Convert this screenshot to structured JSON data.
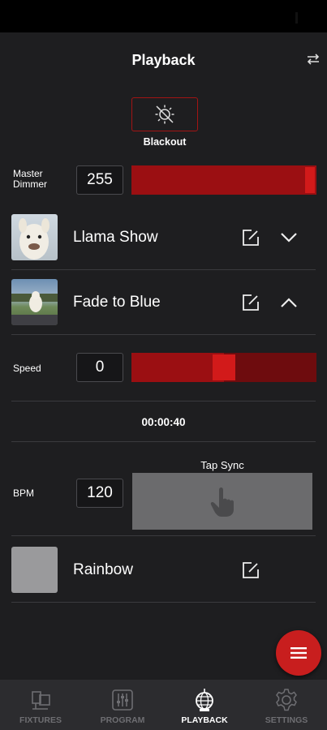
{
  "header": {
    "title": "Playback"
  },
  "blackout": {
    "label": "Blackout"
  },
  "master": {
    "label_line1": "Master",
    "label_line2": "Dimmer",
    "value": "255",
    "level": 1.0
  },
  "shows": [
    {
      "name": "Llama Show",
      "expanded": false
    },
    {
      "name": "Fade to Blue",
      "expanded": true
    }
  ],
  "speed": {
    "label": "Speed",
    "value": "0",
    "level": 0.5
  },
  "timer": "00:00:40",
  "bpm": {
    "label": "BPM",
    "value": "120",
    "tap_label": "Tap Sync"
  },
  "rainbow": {
    "name": "Rainbow"
  },
  "nav": [
    {
      "label": "FIXTURES",
      "icon": "fixture-icon",
      "active": false
    },
    {
      "label": "PROGRAM",
      "icon": "sliders-icon",
      "active": false
    },
    {
      "label": "PLAYBACK",
      "icon": "disco-ball-icon",
      "active": true
    },
    {
      "label": "SETTINGS",
      "icon": "gear-icon",
      "active": false
    }
  ],
  "colors": {
    "accent": "#c81e1e",
    "slider_fill": "#9b0f12",
    "background": "#1e1e20"
  }
}
